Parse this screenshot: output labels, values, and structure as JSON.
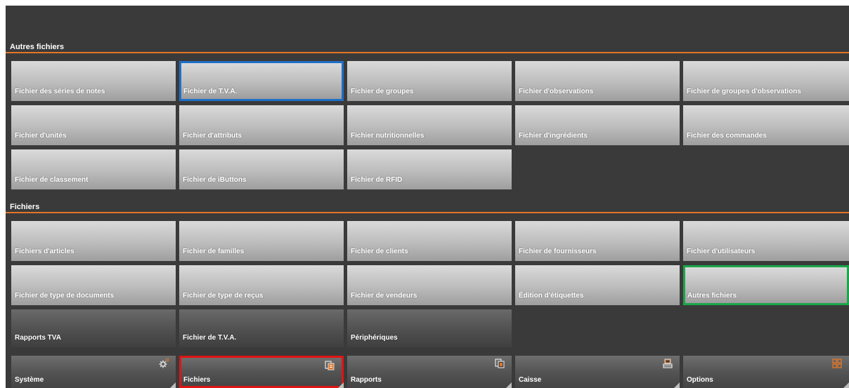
{
  "sections": {
    "autres_fichiers": {
      "title": "Autres fichiers",
      "tiles": [
        "Fichier des séries de notes",
        "Fichier de T.V.A.",
        "Fichier de groupes",
        "Fichier d'observations",
        "Fichier de groupes d'observations",
        "Fichier d'unités",
        "Fichier d'attributs",
        "Fichier nutritionnelles",
        "Fichier d'ingrédients",
        "Fichier des commandes",
        "Fichier de classement",
        "Fichier de iButtons",
        "Fichier de RFID"
      ]
    },
    "fichiers": {
      "title": "Fichiers",
      "tiles": [
        "Fichiers d'articles",
        "Fichier de familles",
        "Fichier de clients",
        "Fichier de fournisseurs",
        "Fichier d'utilisateurs",
        "Fichier de type de documents",
        "Fichier de type de reçus",
        "Fichier de vendeurs",
        "Édition d'étiquettes",
        "Autres fichiers",
        "Rapports TVA",
        "Fichier de T.V.A.",
        "Périphériques"
      ]
    }
  },
  "nav": [
    {
      "label": "Système",
      "icon": "gear-icon"
    },
    {
      "label": "Fichiers",
      "icon": "files-icon"
    },
    {
      "label": "Rapports",
      "icon": "reports-icon"
    },
    {
      "label": "Caisse",
      "icon": "cash-register-icon"
    },
    {
      "label": "Options",
      "icon": "grid-icon"
    }
  ],
  "colors": {
    "accent_line": "#e0762a",
    "selected_blue": "#1e6fc8",
    "selected_green": "#1aa64a",
    "selected_red": "#e01414",
    "icon_orange": "#e0762a"
  }
}
